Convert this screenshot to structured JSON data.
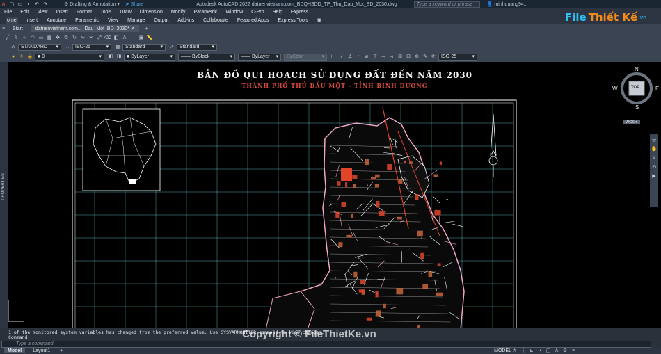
{
  "window": {
    "title": "Autodesk AutoCAD 2022   datnenvietnam.com_BDQHSDD_TP_Thu_Dau_Mot_BD_2030.dwg",
    "workspace": "Drafting & Annotation",
    "share_label": "Share",
    "search_placeholder": "Type a keyword or phrase",
    "user": "minhquang94..."
  },
  "menu": [
    "File",
    "Edit",
    "View",
    "Insert",
    "Format",
    "Tools",
    "Draw",
    "Dimension",
    "Modify",
    "Parametric",
    "Window",
    "C-Pro",
    "Help",
    "Express"
  ],
  "ribbon_tabs": [
    "ome",
    "Insert",
    "Annotate",
    "Parametric",
    "View",
    "Manage",
    "Output",
    "Add-ins",
    "Collaborate",
    "Featured Apps",
    "Express Tools"
  ],
  "doc_tabs": [
    "Start",
    "datnenvietnam.com..._Dau_Mot_BD_2030*"
  ],
  "styles": {
    "text_style": "STANDARD",
    "dim_style": "ISO-25",
    "table_style": "Standard",
    "mleader_style": "Standard"
  },
  "properties": {
    "layer": "0",
    "color": "ByLayer",
    "linetype": "ByBlock",
    "lineweight": "ByLayer",
    "plotstyle": "ByColor",
    "dim_style2": "ISO-25"
  },
  "side_panel": "PROPERTIES",
  "map": {
    "title": "BẢN ĐỒ QUI HOẠCH SỬ DỤNG ĐẤT ĐẾN NĂM 2030",
    "subtitle": "THÀNH PHỐ THỦ DẦU MỘT - TỈNH BÌNH DƯƠNG"
  },
  "viewcube": {
    "n": "N",
    "s": "S",
    "e": "E",
    "w": "W",
    "top": "TOP",
    "wcs": "WCS"
  },
  "command": {
    "history": "1 of the monitored system variables has changed from the preferred value. Use SYSVARMONITOR command to view changes.",
    "prompt": "Command:",
    "placeholder": "Type a command"
  },
  "status": {
    "model_tab": "Model",
    "layout_tab": "Layout1",
    "mode": "MODEL"
  },
  "watermark": "Copyright © FileThietKe.vn",
  "logo": {
    "part1": "File",
    "part2": "Thiết Kế",
    "part3": ".vn"
  },
  "colors": {
    "canvas": "#000000",
    "grid": "#6fe3e3",
    "roads": "#ffffff",
    "landuse_red": "#e0452a",
    "accent_blue": "#2ec2f0"
  }
}
